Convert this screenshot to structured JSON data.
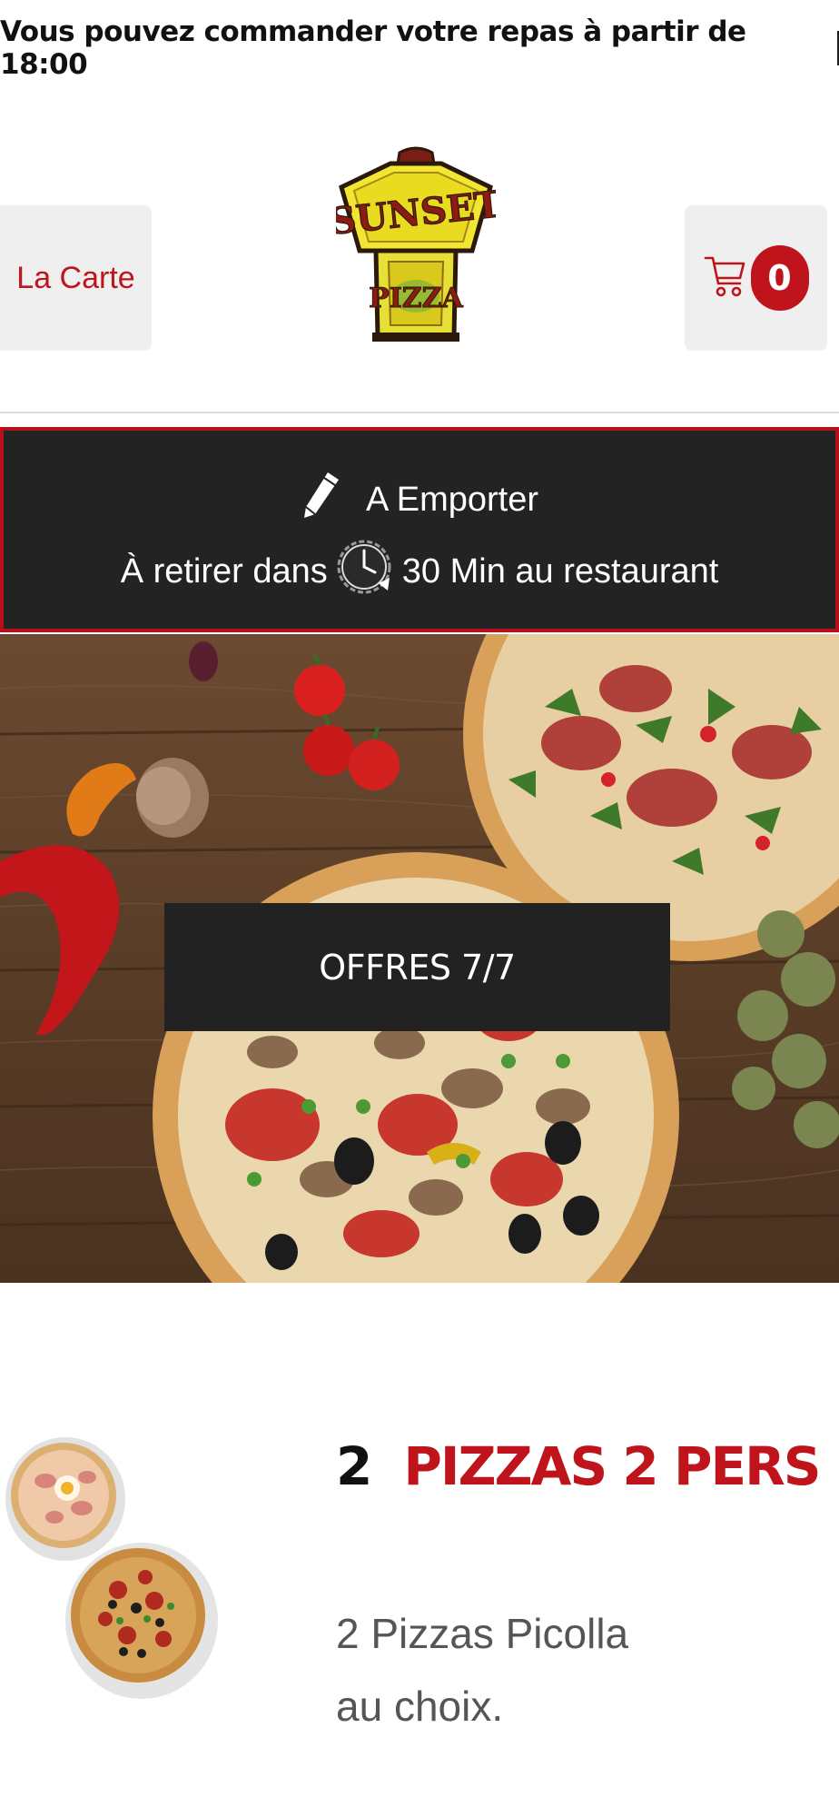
{
  "notice": {
    "text": "Vous pouvez commander votre repas à partir de 18:00"
  },
  "header": {
    "menu_label": "La Carte",
    "logo_alt": "Sunset Pizza",
    "cart_count": "0"
  },
  "mode": {
    "type_label": "A Emporter",
    "pickup_prefix": "À retirer dans",
    "pickup_suffix": "30 Min au restaurant"
  },
  "hero": {
    "offers_label": "OFFRES 7/7"
  },
  "product": {
    "quantity": "2",
    "name": "PIZZAS 2 PERS",
    "desc_line1": "2 Pizzas Picolla",
    "desc_line2": "au choix."
  },
  "colors": {
    "accent": "#c0141c",
    "banner_bg": "#232323",
    "button_bg": "#efefef"
  },
  "icons": [
    "shopping-cart-icon",
    "pencil-icon",
    "clock-icon"
  ]
}
